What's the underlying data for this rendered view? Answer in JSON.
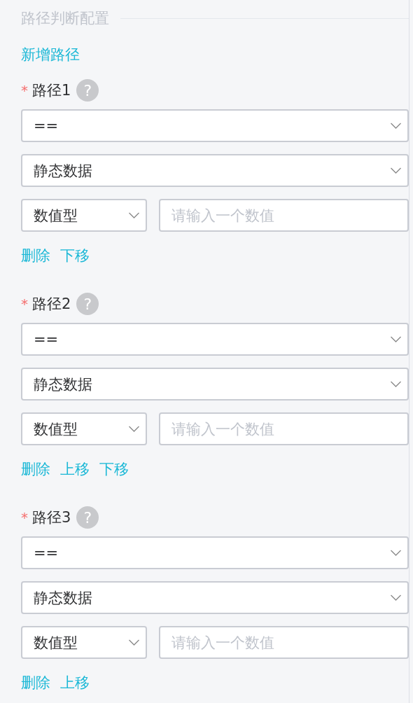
{
  "section_title": "路径判断配置",
  "add_link": "新增路径",
  "paths": [
    {
      "required_mark": "*",
      "label": "路径1",
      "help": "?",
      "operator": "==",
      "source": "静态数据",
      "value_type": "数值型",
      "value_placeholder": "请输入一个数值",
      "actions": [
        "删除",
        "下移"
      ]
    },
    {
      "required_mark": "*",
      "label": "路径2",
      "help": "?",
      "operator": "==",
      "source": "静态数据",
      "value_type": "数值型",
      "value_placeholder": "请输入一个数值",
      "actions": [
        "删除",
        "上移",
        "下移"
      ]
    },
    {
      "required_mark": "*",
      "label": "路径3",
      "help": "?",
      "operator": "==",
      "source": "静态数据",
      "value_type": "数值型",
      "value_placeholder": "请输入一个数值",
      "actions": [
        "删除",
        "上移"
      ]
    }
  ]
}
